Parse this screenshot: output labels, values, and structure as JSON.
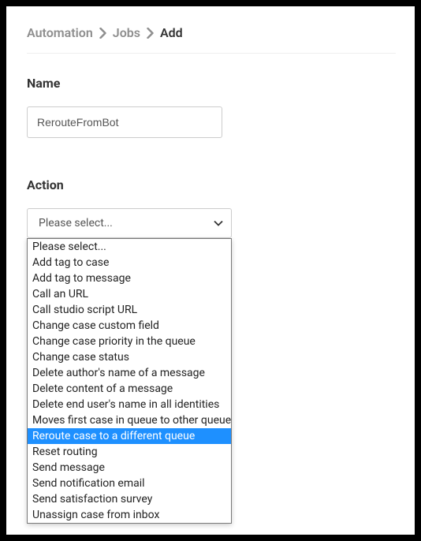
{
  "breadcrumb": {
    "items": [
      "Automation",
      "Jobs",
      "Add"
    ],
    "current_index": 2
  },
  "name_section": {
    "label": "Name",
    "value": "RerouteFromBot"
  },
  "action_section": {
    "label": "Action",
    "placeholder": "Please select...",
    "highlighted_index": 12,
    "options": [
      "Please select...",
      "Add tag to case",
      "Add tag to message",
      "Call an URL",
      "Call studio script URL",
      "Change case custom field",
      "Change case priority in the queue",
      "Change case status",
      "Delete author's name of a message",
      "Delete content of a message",
      "Delete end user's name in all identities",
      "Moves first case in queue to other queue",
      "Reroute case to a different queue",
      "Reset routing",
      "Send message",
      "Send notification email",
      "Send satisfaction survey",
      "Unassign case from inbox"
    ]
  }
}
